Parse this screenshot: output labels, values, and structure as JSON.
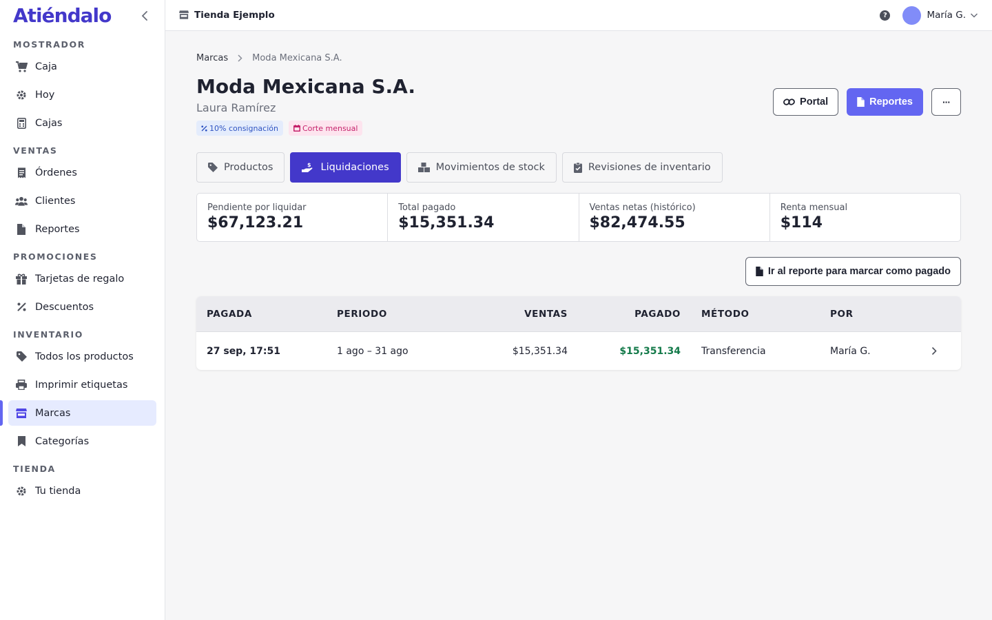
{
  "app": {
    "brand": "Atiéndalo",
    "store_name": "Tienda Ejemplo",
    "user_name": "María G."
  },
  "sidebar": {
    "sections": [
      {
        "title": "MOSTRADOR",
        "items": [
          {
            "label": "Caja",
            "icon": "cart-icon"
          },
          {
            "label": "Hoy",
            "icon": "gear-icon"
          },
          {
            "label": "Cajas",
            "icon": "calculator-icon"
          }
        ]
      },
      {
        "title": "VENTAS",
        "items": [
          {
            "label": "Órdenes",
            "icon": "receipt-icon"
          },
          {
            "label": "Clientes",
            "icon": "users-icon"
          },
          {
            "label": "Reportes",
            "icon": "file-icon"
          }
        ]
      },
      {
        "title": "PROMOCIONES",
        "items": [
          {
            "label": "Tarjetas de regalo",
            "icon": "gift-icon"
          },
          {
            "label": "Descuentos",
            "icon": "percent-icon"
          }
        ]
      },
      {
        "title": "INVENTARIO",
        "items": [
          {
            "label": "Todos los productos",
            "icon": "tag-icon"
          },
          {
            "label": "Imprimir etiquetas",
            "icon": "printer-icon"
          },
          {
            "label": "Marcas",
            "icon": "store-icon",
            "active": true
          },
          {
            "label": "Categorías",
            "icon": "bookmark-icon"
          }
        ]
      },
      {
        "title": "TIENDA",
        "items": [
          {
            "label": "Tu tienda",
            "icon": "gear-icon"
          }
        ]
      }
    ]
  },
  "breadcrumb": {
    "parent": "Marcas",
    "current": "Moda Mexicana S.A."
  },
  "brand_detail": {
    "title": "Moda Mexicana S.A.",
    "contact": "Laura Ramírez",
    "badges": {
      "consignment": "10% consignación",
      "cut": "Corte mensual"
    }
  },
  "actions": {
    "portal": "Portal",
    "reports": "Reportes",
    "more": "···"
  },
  "tabs": {
    "products": "Productos",
    "settlements": "Liquidaciones",
    "stock": "Movimientos de stock",
    "reviews": "Revisiones de inventario"
  },
  "stats": [
    {
      "label": "Pendiente por liquidar",
      "value": "$67,123.21"
    },
    {
      "label": "Total pagado",
      "value": "$15,351.34"
    },
    {
      "label": "Ventas netas (histórico)",
      "value": "$82,474.55"
    },
    {
      "label": "Renta mensual",
      "value": "$114"
    }
  ],
  "report_button": "Ir al reporte para marcar como pagado",
  "table": {
    "headers": {
      "paid_at": "PAGADA",
      "period": "PERIODO",
      "sales": "VENTAS",
      "paid": "PAGADO",
      "method": "MÉTODO",
      "by": "POR"
    },
    "rows": [
      {
        "paid_at": "27 sep, 17:51",
        "period": "1 ago – 31 ago",
        "sales": "$15,351.34",
        "paid": "$15,351.34",
        "method": "Transferencia",
        "by": "María G."
      }
    ]
  },
  "colors": {
    "accent": "#6366f1",
    "accent_dark": "#4338ca",
    "paid_green": "#147a4a"
  }
}
